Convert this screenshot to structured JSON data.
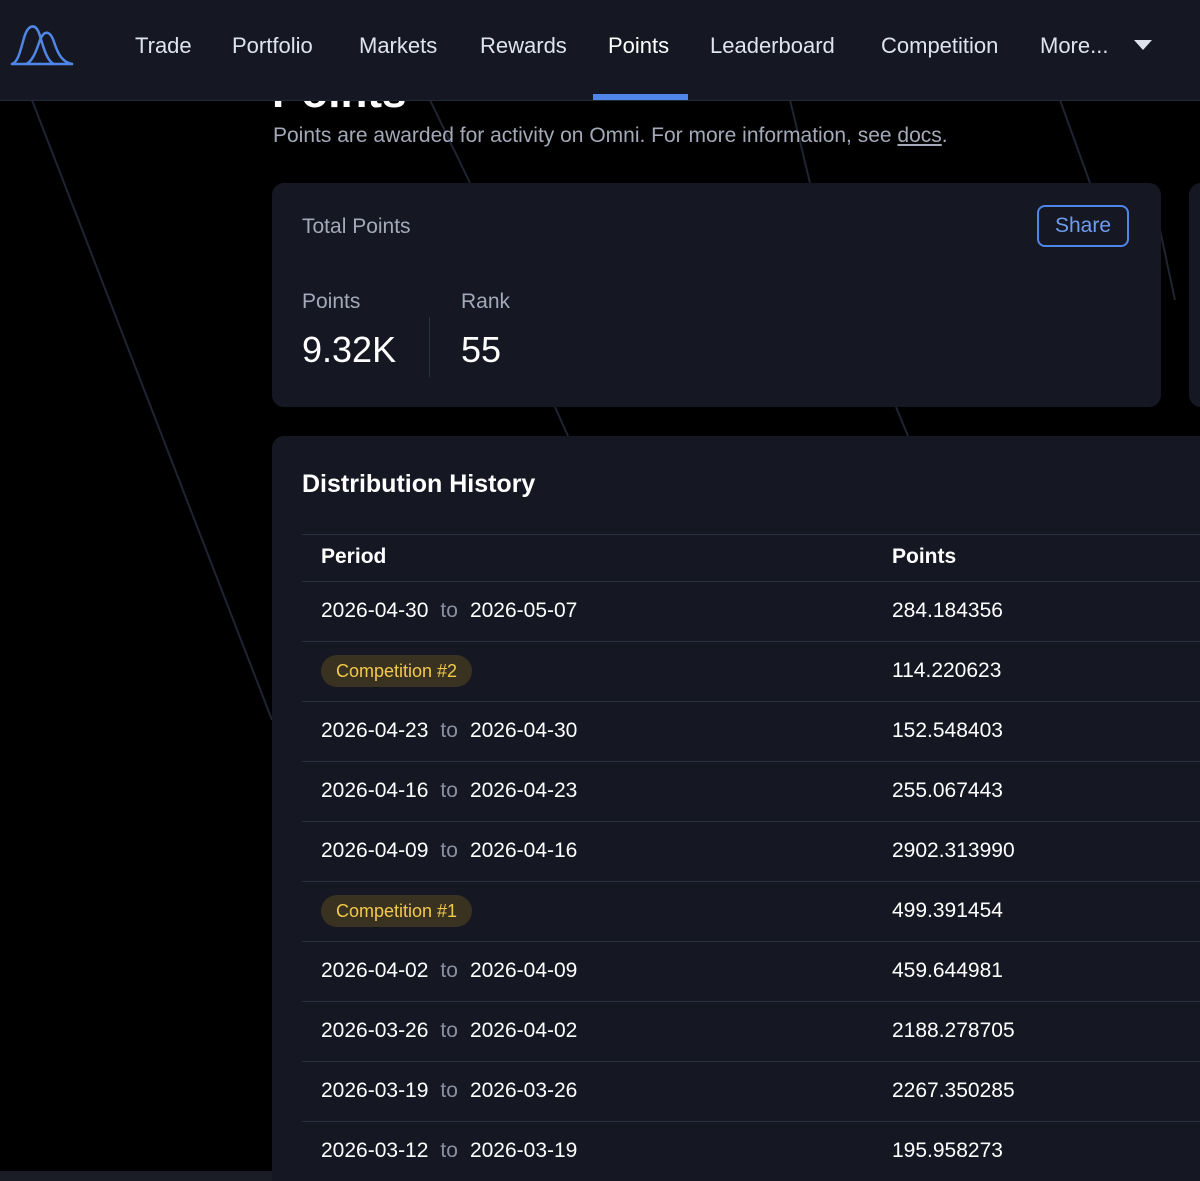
{
  "nav": {
    "items": [
      {
        "label": "Trade",
        "active": false
      },
      {
        "label": "Portfolio",
        "active": false
      },
      {
        "label": "Markets",
        "active": false
      },
      {
        "label": "Rewards",
        "active": false
      },
      {
        "label": "Points",
        "active": true
      },
      {
        "label": "Leaderboard",
        "active": false
      },
      {
        "label": "Competition",
        "active": false
      },
      {
        "label": "More...",
        "active": false
      }
    ],
    "more_icon": "chevron-down-icon"
  },
  "header": {
    "title": "Points",
    "subtitle_text": "Points are awarded for activity on Omni. For more information, see ",
    "subtitle_link": "docs",
    "subtitle_end": "."
  },
  "total": {
    "label": "Total Points",
    "share_label": "Share",
    "points_label": "Points",
    "points_value": "9.32K",
    "rank_label": "Rank",
    "rank_value": "55"
  },
  "history": {
    "title": "Distribution History",
    "columns": {
      "period": "Period",
      "points": "Points"
    },
    "to_label": "to",
    "rows": [
      {
        "start": "2026-04-30",
        "end": "2026-05-07",
        "points": "284.184356"
      },
      {
        "badge": "Competition #2",
        "points": "114.220623"
      },
      {
        "start": "2026-04-23",
        "end": "2026-04-30",
        "points": "152.548403"
      },
      {
        "start": "2026-04-16",
        "end": "2026-04-23",
        "points": "255.067443"
      },
      {
        "start": "2026-04-09",
        "end": "2026-04-16",
        "points": "2902.313990"
      },
      {
        "badge": "Competition #1",
        "points": "499.391454"
      },
      {
        "start": "2026-04-02",
        "end": "2026-04-09",
        "points": "459.644981"
      },
      {
        "start": "2026-03-26",
        "end": "2026-04-02",
        "points": "2188.278705"
      },
      {
        "start": "2026-03-19",
        "end": "2026-03-26",
        "points": "2267.350285"
      },
      {
        "start": "2026-03-12",
        "end": "2026-03-19",
        "points": "195.958273"
      }
    ]
  },
  "colors": {
    "background": "#000000",
    "surface": "#151822",
    "accent": "#4f86e8",
    "badge_bg": "#3a3220",
    "badge_text": "#f2c94c",
    "muted_text": "#a3a9b8"
  }
}
